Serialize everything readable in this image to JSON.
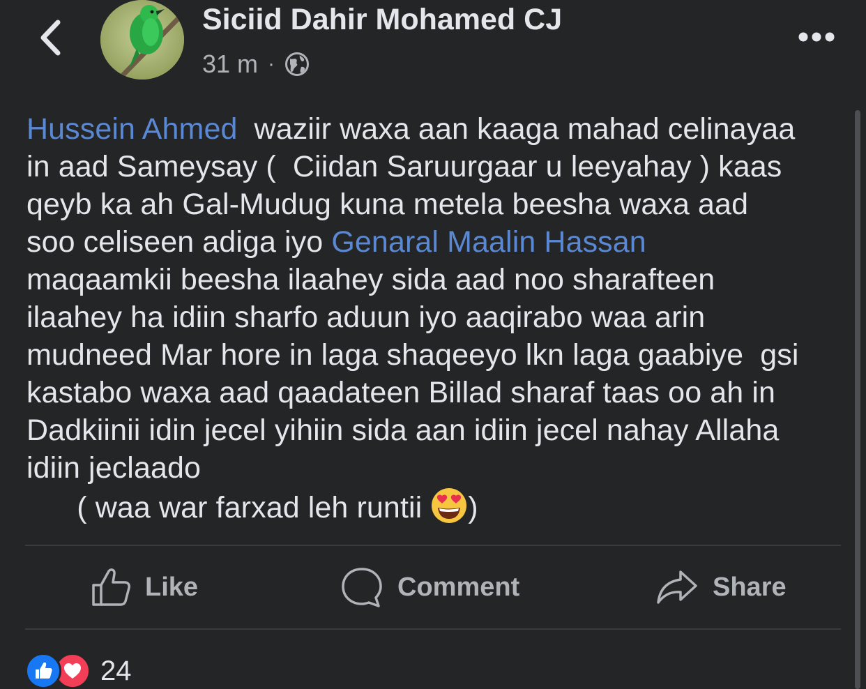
{
  "post": {
    "author": "Siciid Dahir Mohamed CJ",
    "time": "31 m",
    "separator": "·",
    "privacy_icon": "globe-icon",
    "body_lines": [
      {
        "segments": [
          {
            "text": "Hussein Ahmed",
            "type": "mention"
          },
          {
            "text": "  waziir waxa aan kaaga mahad celinayaa",
            "type": "text"
          }
        ]
      },
      {
        "segments": [
          {
            "text": "in aad Sameysay (  Ciidan Saruurgaar u leeyahay ) kaas",
            "type": "text"
          }
        ]
      },
      {
        "segments": [
          {
            "text": "qeyb ka ah Gal-Mudug kuna metela beesha waxa aad",
            "type": "text"
          }
        ]
      },
      {
        "segments": [
          {
            "text": "soo celiseen adiga iyo ",
            "type": "text"
          },
          {
            "text": "Genaral Maalin Hassan",
            "type": "mention"
          }
        ]
      },
      {
        "segments": [
          {
            "text": "maqaamkii beesha ilaahey sida aad noo sharafteen",
            "type": "text"
          }
        ]
      },
      {
        "segments": [
          {
            "text": "ilaahey ha idiin sharfo aduun iyo aaqirabo waa arin",
            "type": "text"
          }
        ]
      },
      {
        "segments": [
          {
            "text": "mudneed Mar hore in laga shaqeeyo lkn laga gaabiye  gsi",
            "type": "text"
          }
        ]
      },
      {
        "segments": [
          {
            "text": "kastabo waxa aad qaadateen Billad sharaf taas oo ah in",
            "type": "text"
          }
        ]
      },
      {
        "segments": [
          {
            "text": "Dadkiinii idin jecel yihiin sida aan idiin jecel nahay Allaha",
            "type": "text"
          }
        ]
      },
      {
        "segments": [
          {
            "text": "idiin jeclaado",
            "type": "text"
          }
        ]
      },
      {
        "segments": [
          {
            "text": "      ( waa war farxad leh runtii",
            "type": "text"
          },
          {
            "text": "heart-eyes-emoji",
            "type": "emoji"
          },
          {
            "text": ")",
            "type": "text"
          }
        ]
      }
    ]
  },
  "actions": {
    "like_label": "Like",
    "comment_label": "Comment",
    "share_label": "Share"
  },
  "reactions": {
    "count": "24",
    "icons": [
      "thumbs-up-reaction",
      "heart-reaction"
    ]
  },
  "colors": {
    "background": "#242527",
    "text": "#e4e6eb",
    "secondary_text": "#b0b3b8",
    "mention": "#5b88d3",
    "like_blue": "#1877f2",
    "love_red": "#f33e58"
  }
}
